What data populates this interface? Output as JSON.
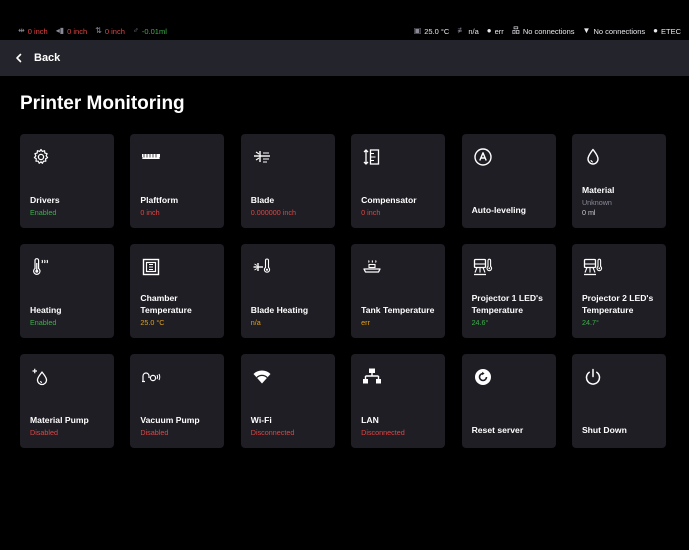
{
  "statusbar": {
    "left": [
      {
        "icon": "platform-position-icon",
        "glyph": "⇹",
        "text": "0 inch",
        "color": "#e14545"
      },
      {
        "icon": "blade-position-icon",
        "glyph": "◂▮",
        "text": "0 inch",
        "color": "#e14545"
      },
      {
        "icon": "compensator-position-icon",
        "glyph": "⇅",
        "text": "0 inch",
        "color": "#e14545"
      },
      {
        "icon": "material-volume-icon",
        "glyph": "♂",
        "text": "-0.01ml",
        "color": "#3fae4b"
      }
    ],
    "right": [
      {
        "icon": "chamber-temperature-icon",
        "glyph": "▣",
        "text": "25.0 °C"
      },
      {
        "icon": "blade-heating-icon",
        "glyph": "≢",
        "text": "n/a"
      },
      {
        "icon": "material-drop-icon",
        "glyph": "●",
        "text": "err"
      },
      {
        "icon": "lan-icon",
        "glyph": "品",
        "text": "No connections"
      },
      {
        "icon": "wifi-icon",
        "glyph": "▼",
        "text": "No connections"
      },
      {
        "icon": "device-icon",
        "glyph": "●",
        "text": "ETEC"
      }
    ]
  },
  "topbar": {
    "back_label": "Back"
  },
  "page_title": "Printer Monitoring",
  "cards": [
    {
      "id": "drivers",
      "icon": "gear-icon",
      "name": "Drivers",
      "status": "Enabled",
      "status_color": "#3fae4b"
    },
    {
      "id": "platform",
      "icon": "platform-icon",
      "name": "Plaftform",
      "status": "0 inch",
      "status_color": "#e14545"
    },
    {
      "id": "blade",
      "icon": "blade-icon",
      "name": "Blade",
      "status": "0.000000 inch",
      "status_color": "#e14545"
    },
    {
      "id": "compensator",
      "icon": "compensator-icon",
      "name": "Compensator",
      "status": "0 inch",
      "status_color": "#e14545"
    },
    {
      "id": "auto-leveling",
      "icon": "auto-leveling-icon",
      "name": "Auto-leveling",
      "status": "",
      "status_color": "#ffffff"
    },
    {
      "id": "material",
      "icon": "drop-icon",
      "name": "Material",
      "status": "Unknown",
      "status2": "0 ml",
      "status_color": "#8a8a96"
    },
    {
      "id": "heating",
      "icon": "thermometer-icon",
      "name": "Heating",
      "status": "Enabled",
      "status_color": "#3fae4b"
    },
    {
      "id": "chamber-temperature",
      "icon": "chamber-icon",
      "name": "Chamber Temperature",
      "status": "25.0 °C",
      "status_color": "#e3a21a"
    },
    {
      "id": "blade-heating",
      "icon": "blade-heating-icon",
      "name": "Blade Heating",
      "status": "n/a",
      "status_color": "#e3a21a"
    },
    {
      "id": "tank-temperature",
      "icon": "tank-icon",
      "name": "Tank Temperature",
      "status": "err",
      "status_color": "#e3a21a"
    },
    {
      "id": "projector-1",
      "icon": "projector-icon",
      "name": "Projector 1 LED's Temperature",
      "status": "24.6°",
      "status_color": "#3fae4b"
    },
    {
      "id": "projector-2",
      "icon": "projector-icon",
      "name": "Projector 2 LED's Temperature",
      "status": "24.7°",
      "status_color": "#3fae4b"
    },
    {
      "id": "material-pump",
      "icon": "pump-drop-icon",
      "name": "Material Pump",
      "status": "Disabled",
      "status_color": "#e14545"
    },
    {
      "id": "vacuum-pump",
      "icon": "vacuum-icon",
      "name": "Vacuum Pump",
      "status": "Disabled",
      "status_color": "#e14545"
    },
    {
      "id": "wifi",
      "icon": "wifi-icon",
      "name": "Wi-Fi",
      "status": "Disconnected",
      "status_color": "#e14545"
    },
    {
      "id": "lan",
      "icon": "lan-icon",
      "name": "LAN",
      "status": "Disconnected",
      "status_color": "#e14545"
    },
    {
      "id": "reset-server",
      "icon": "reset-icon",
      "name": "Reset server",
      "status": "",
      "status_color": "#ffffff"
    },
    {
      "id": "shut-down",
      "icon": "power-icon",
      "name": "Shut Down",
      "status": "",
      "status_color": "#ffffff"
    }
  ]
}
